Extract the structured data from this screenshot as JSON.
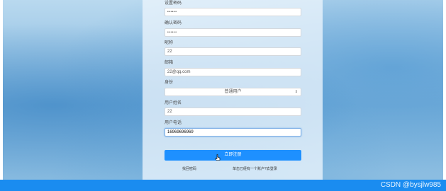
{
  "form": {
    "fields": [
      {
        "label": "设置密码",
        "value": "••••••"
      },
      {
        "label": "确认密码",
        "value": "••••••"
      },
      {
        "label": "昵称",
        "value": "22"
      },
      {
        "label": "邮箱",
        "value": "22@qq.com"
      },
      {
        "label": "身份",
        "value": "普通用户"
      },
      {
        "label": "用户姓名",
        "value": "22"
      },
      {
        "label": "用户电话",
        "value": "16969696969"
      }
    ],
    "submit_label": "立即注册",
    "link_left": "找回密码",
    "link_right": "单击已经有一个账户?去登录"
  },
  "watermark": "CSDN @bysjlw985",
  "colors": {
    "button": "#1e90ff",
    "bottom_bar": "#1a8cf0"
  }
}
